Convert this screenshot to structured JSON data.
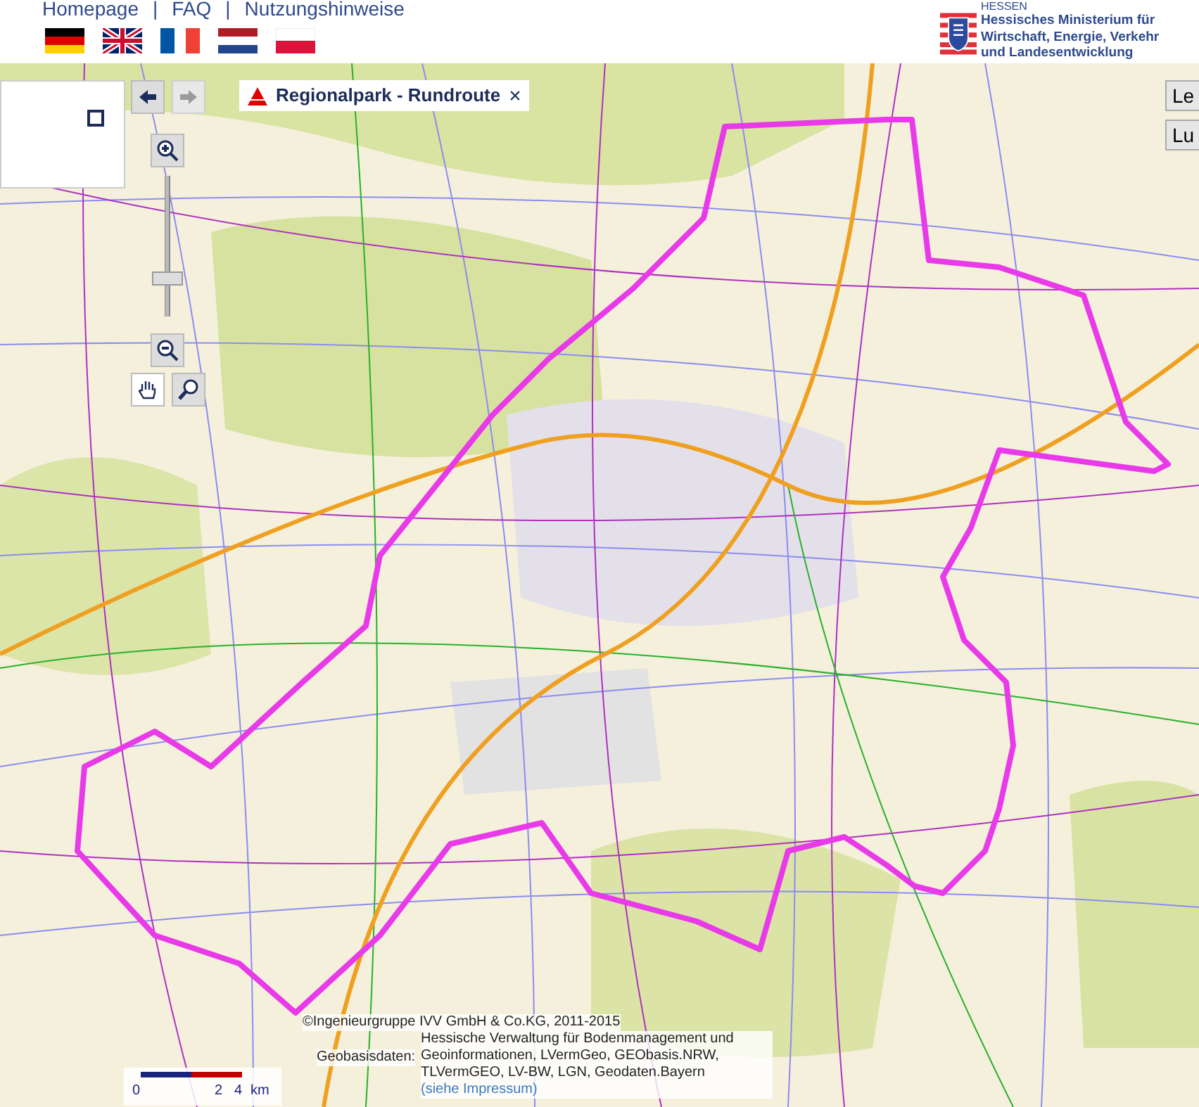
{
  "header": {
    "links": [
      {
        "label": "Homepage"
      },
      {
        "label": "FAQ",
        "separator_before": "|"
      },
      {
        "label": "Nutzungshinweise",
        "separator_before": "|"
      }
    ]
  },
  "logo": {
    "state": "HESSEN",
    "lines": [
      "Hessisches Ministerium für",
      "Wirtschaft, Energie, Verkehr",
      "und Landesentwicklung"
    ]
  },
  "map": {
    "history": {
      "back": {
        "disabled": false
      },
      "forward": {
        "disabled": true
      }
    },
    "layer_tab": {
      "title": "Regionalpark - Rundroute",
      "close": "×"
    },
    "zoom_slider": {
      "level": 0.25
    },
    "side_buttons": [
      "Le",
      "Lu"
    ],
    "attribution": {
      "copyright": "©Ingenieurgruppe IVV GmbH & Co.KG, 2011-2015",
      "label": "Geobasisdaten:",
      "text": "Hessische Verwaltung für Bodenmanagement und Geoinformationen, LVermGeo, GEObasis.NRW, TLVermGEO, LV-BW, LGN, Geodaten.Bayern",
      "link": "(siehe Impressum)"
    },
    "scale": {
      "labels": [
        "0",
        "2",
        "4"
      ],
      "unit": "km"
    }
  }
}
